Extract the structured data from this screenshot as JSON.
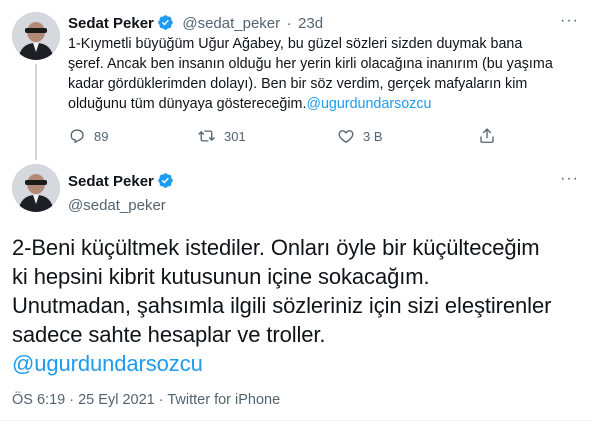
{
  "tweet1": {
    "display_name": "Sedat Peker",
    "handle": "@sedat_peker",
    "separator": "·",
    "time_ago": "23d",
    "more_label": "···",
    "text_lines": [
      "1-Kıymetli büyüğüm Uğur Ağabey, bu güzel sözleri sizden duymak bana",
      "şeref. Ancak ben insanın olduğu her yerin kirli olacağına inanırım (bu yaşıma",
      "kadar gördüklerimden dolayı). Ben bir söz verdim, gerçek mafyaların kim",
      "olduğunu tüm dünyaya göstereceğim."
    ],
    "mention": "@ugurdundarsozcu",
    "replies": "89",
    "retweets": "301",
    "likes": "3 B"
  },
  "tweet2": {
    "display_name": "Sedat Peker",
    "handle": "@sedat_peker",
    "more_label": "···",
    "text_lines": [
      "2-Beni küçültmek istediler. Onları öyle bir küçülteceğim",
      "ki hepsini kibrit kutusunun içine sokacağım.",
      "Unutmadan, şahsımla ilgili sözleriniz için sizi eleştirenler",
      "sadece sahte hesaplar ve troller."
    ],
    "mention": "@ugurdundarsozcu",
    "time": "ÖS 6:19",
    "date": "25 Eyl 2021",
    "separator": "·",
    "source": "Twitter for iPhone"
  },
  "colors": {
    "verified": "#1d9bf0",
    "mention": "#1d9bf0",
    "secondary_text": "#536471"
  },
  "icons": [
    "verified-badge-icon",
    "reply-icon",
    "retweet-icon",
    "like-icon",
    "share-icon",
    "more-icon"
  ]
}
